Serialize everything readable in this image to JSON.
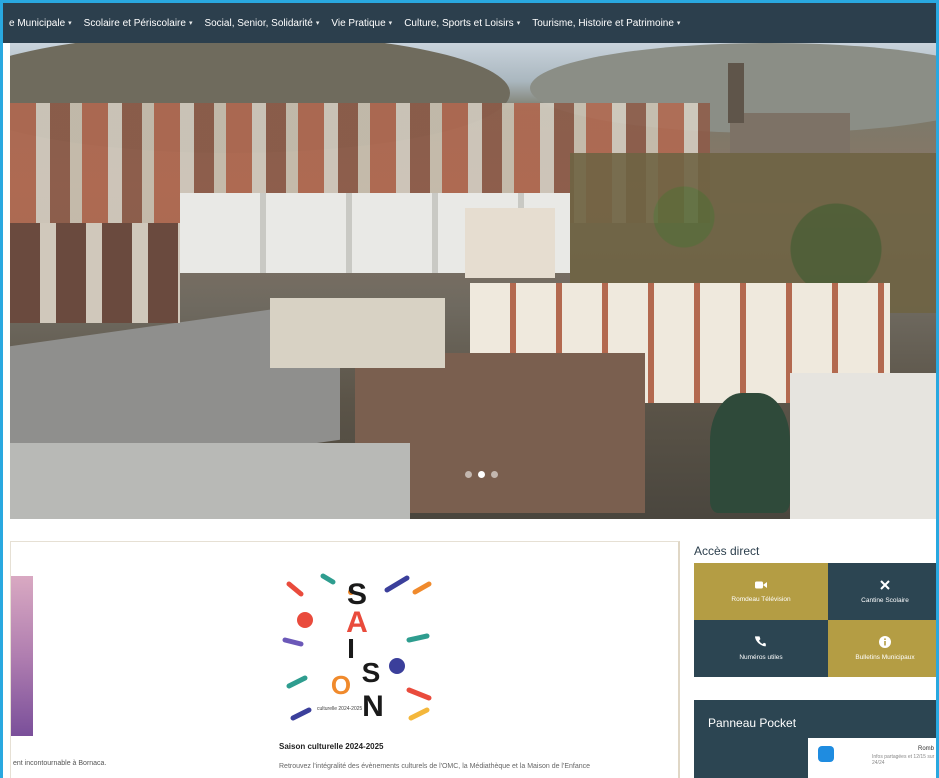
{
  "nav": {
    "items": [
      {
        "label": "e Municipale"
      },
      {
        "label": "Scolaire et Périscolaire"
      },
      {
        "label": "Social, Senior, Solidarité"
      },
      {
        "label": "Vie Pratique"
      },
      {
        "label": "Culture, Sports et Loisirs"
      },
      {
        "label": "Tourisme, Histoire et Patrimoine"
      }
    ],
    "caret": "▾"
  },
  "news": {
    "left_caption": "ent incontournable à Bornaca.",
    "title": "Saison culturelle 2024-2025",
    "description": "Retrouvez l'intégralité des évènements culturels de l'OMC, la Médiathèque et la Maison de l'Enfance",
    "poster_letters": [
      "S",
      "A",
      "I",
      "S",
      "O",
      "N"
    ],
    "poster_small": "culturelle 2024-2025"
  },
  "acces": {
    "title": "Accès direct",
    "tiles": [
      {
        "label": "Romdeau Télévision",
        "icon": "video-camera-icon"
      },
      {
        "label": "Cantine Scolaire",
        "icon": "utensils-icon"
      },
      {
        "label": "Numéros utiles",
        "icon": "phone-icon"
      },
      {
        "label": "Bulletins Municipaux",
        "icon": "info-icon"
      }
    ]
  },
  "panneau": {
    "title": "Panneau Pocket",
    "line1": "Romb",
    "line2": "Infos partagées et 12/15 sur 24/24"
  },
  "colors": {
    "nav": "#2c3f4d",
    "gold": "#b49d44",
    "dark_tile": "#2c4552",
    "frame": "#29a8e0"
  },
  "hero": {
    "slides": 3,
    "active_slide": 1
  }
}
